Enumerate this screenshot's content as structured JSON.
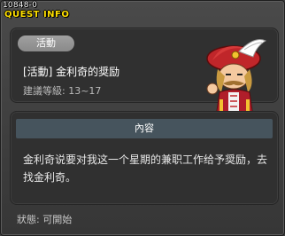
{
  "window": {
    "quest_id": "10848-0",
    "title": "QUEST INFO"
  },
  "quest": {
    "category": "活動",
    "name": "[活動] 金利奇的奨励",
    "level_label": "建議等級:",
    "level_range": "13~17"
  },
  "content": {
    "header": "內容",
    "body": "金利奇说要对我这一个星期的兼职工作给予奨励，去找金利奇。"
  },
  "status": {
    "label": "狀態:",
    "value": "可開始"
  },
  "colors": {
    "title": "#ffe000",
    "badge": "#959595",
    "content_header": "#46545d"
  },
  "icons": {
    "npc": "npc-portrait"
  }
}
